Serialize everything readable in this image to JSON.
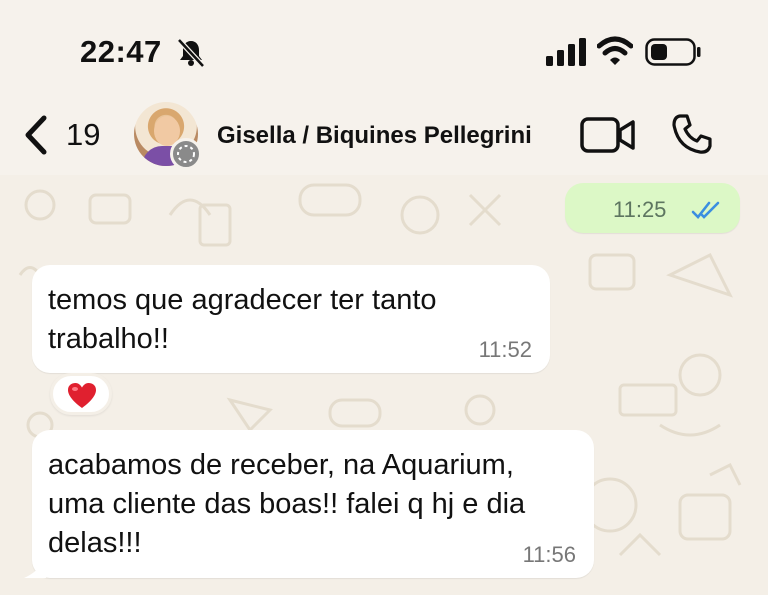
{
  "status_bar": {
    "time": "22:47",
    "icons": [
      "bell-slash-icon",
      "cellular-signal-icon",
      "wifi-icon",
      "battery-icon"
    ]
  },
  "header": {
    "back_count": "19",
    "contact_name": "Gisella / Biquines Pellegrini",
    "icons": [
      "chevron-left-icon",
      "avatar",
      "video-call-icon",
      "phone-icon"
    ]
  },
  "messages": [
    {
      "direction": "outgoing",
      "text": "",
      "time": "11:25",
      "status": "read"
    },
    {
      "direction": "incoming",
      "text": "temos que agradecer ter tanto trabalho!!",
      "time": "11:52",
      "reaction": "❤️"
    },
    {
      "direction": "incoming",
      "text": "acabamos de receber, na Aquarium, uma cliente das boas!! falei q hj e dia delas!!!",
      "time": "11:56"
    }
  ],
  "colors": {
    "chat_background": "#f4efe7",
    "outgoing_bubble": "#dcf8c6",
    "incoming_bubble": "#ffffff",
    "read_ticks": "#3b8ee0"
  }
}
